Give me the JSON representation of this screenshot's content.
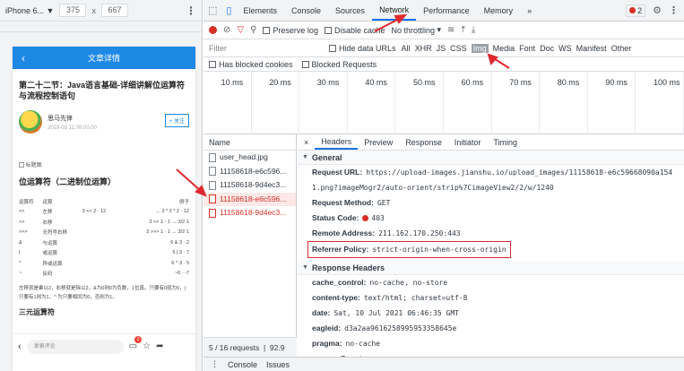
{
  "device": {
    "model": "iPhone 6...",
    "width": "375",
    "x_sep": "x",
    "height": "667"
  },
  "phone": {
    "nav_title": "文章详情",
    "back_glyph": "‹",
    "article_title": "第二十二节：Java语言基础-详细讲解位运算符与流程控制语句",
    "author_name": "思马先锋",
    "author_date": "2019-03 11:09:00.00",
    "follow_label": "+ 关注",
    "broken_image_alt": "标题图",
    "section_heading": "位运算符（二进制位运算）",
    "table_rows": [
      [
        "运算符",
        "运算",
        "",
        "例子"
      ],
      [
        "<<",
        "左移",
        "3 << 2 · 12",
        "→ 3 * 2 * 2 · 12"
      ],
      [
        ">>",
        "右移",
        "",
        "3 >> 1 · 1 → 3/2·1"
      ],
      [
        ">>>",
        "无符号右移",
        "",
        "3 >>> 1 · 1 → 3/2·1"
      ],
      [
        "&",
        "与运算",
        "",
        "6 & 3 · 2"
      ],
      [
        "|",
        "或运算",
        "",
        "6 | 3 · 7"
      ],
      [
        "^",
        "异或运算",
        "",
        "6 ^ 3 · 5"
      ],
      [
        "~",
        "反码",
        "",
        "~6 · -7"
      ]
    ],
    "paragraph": "左移就是乘以2，右移就是除以2，&为0则0为负数，1位真。只要有0就为0，| 只要有1则为1，^ 为只要相同为0，否则为1。",
    "next_heading": "三元运算符",
    "comment_placeholder": "发表评论",
    "badge": "2"
  },
  "devtools": {
    "tabs": [
      "Elements",
      "Console",
      "Sources",
      "Network",
      "Performance",
      "Memory"
    ],
    "more_tabs": "»",
    "error_count": "2",
    "toolbar": {
      "preserve_log": "Preserve log",
      "disable_cache": "Disable cache",
      "throttling": "No throttling"
    },
    "filter": {
      "placeholder": "Filter",
      "hide_data_urls": "Hide data URLs",
      "types": [
        "All",
        "XHR",
        "JS",
        "CSS",
        "Img",
        "Media",
        "Font",
        "Doc",
        "WS",
        "Manifest",
        "Other"
      ],
      "selected_type": "Img",
      "has_blocked_cookies": "Has blocked cookies",
      "blocked_requests": "Blocked Requests"
    },
    "timeline_ticks": [
      "10 ms",
      "20 ms",
      "30 ms",
      "40 ms",
      "50 ms",
      "60 ms",
      "70 ms",
      "80 ms",
      "90 ms",
      "100 ms"
    ],
    "requests": {
      "header": "Name",
      "rows": [
        {
          "name": "user_head.jpg",
          "error": false,
          "selected": false
        },
        {
          "name": "11158618-e6c596...",
          "error": false,
          "selected": false
        },
        {
          "name": "11158618-9d4ec3...",
          "error": false,
          "selected": false
        },
        {
          "name": "11158618-e6c596...",
          "error": true,
          "selected": true
        },
        {
          "name": "11158618-9d4ec3...",
          "error": true,
          "selected": false
        }
      ],
      "status_text": "5 / 16 requests",
      "status_extra": "92.9"
    },
    "detail": {
      "close": "×",
      "tabs": [
        "Headers",
        "Preview",
        "Response",
        "Initiator",
        "Timing"
      ],
      "general_label": "General",
      "request_url_key": "Request URL:",
      "request_url_val": "https://upload-images.jianshu.io/upload_images/11158618-e6c59668090a154",
      "request_url_cont": "1.png?imageMogr2/auto-orient/strip%7CimageView2/2/w/1240",
      "method_key": "Request Method:",
      "method_val": "GET",
      "status_key": "Status Code:",
      "status_val": "403",
      "remote_key": "Remote Address:",
      "remote_val": "211.162.170.250:443",
      "policy_key": "Referrer Policy:",
      "policy_val": "strict-origin-when-cross-origin",
      "response_label": "Response Headers",
      "response_headers": [
        {
          "k": "cache_control:",
          "v": "no-cache, no-store"
        },
        {
          "k": "content-type:",
          "v": "text/html; charset=utf-8"
        },
        {
          "k": "date:",
          "v": "Sat, 10 Jul 2021 06:46:35 GMT"
        },
        {
          "k": "eagleid:",
          "v": "d3a2aa9616258995953358645e"
        },
        {
          "k": "pragma:",
          "v": "no-cache"
        },
        {
          "k": "server:",
          "v": "Tengine"
        }
      ]
    },
    "drawer": {
      "more": "⋮",
      "tabs": [
        "Console",
        "Issues"
      ]
    }
  },
  "colors": {
    "accent": "#1a73e8",
    "error": "#d93025",
    "annotation": "#e0282e",
    "phone_header": "#1e88e5"
  }
}
